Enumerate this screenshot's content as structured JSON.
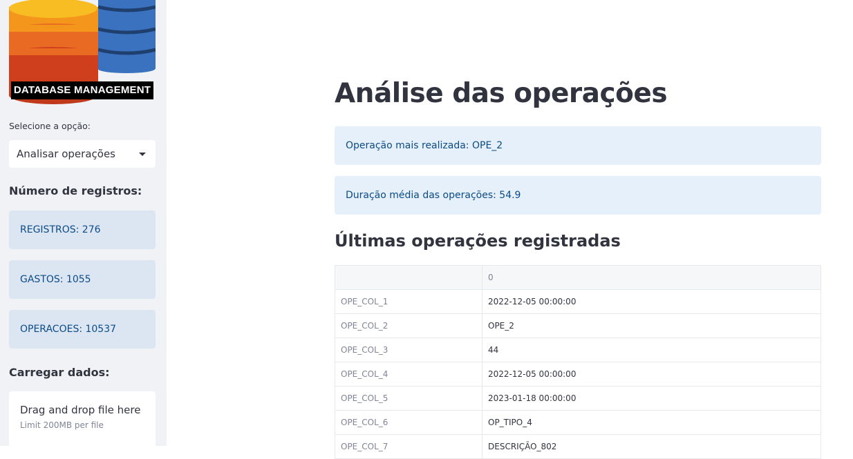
{
  "sidebar": {
    "logo_text": "DATABASE MANAGEMENT",
    "select_label": "Selecione a opção:",
    "select_value": "Analisar operações",
    "records_heading": "Número de registros:",
    "counts": [
      {
        "label": "REGISTROS: 276"
      },
      {
        "label": "GASTOS: 1055"
      },
      {
        "label": "OPERACOES: 10537"
      }
    ],
    "upload_heading": "Carregar dados:",
    "upload_title": "Drag and drop file here",
    "upload_limit": "Limit 200MB per file"
  },
  "main": {
    "title": "Análise das operações",
    "info_most": "Operação mais realizada: OPE_2",
    "info_duration": "Duração média das operações: 54.9",
    "subtitle": "Últimas operações registradas",
    "table": {
      "column_header": "0",
      "rows": [
        {
          "index": "OPE_COL_1",
          "value": "2022-12-05 00:00:00"
        },
        {
          "index": "OPE_COL_2",
          "value": "OPE_2"
        },
        {
          "index": "OPE_COL_3",
          "value": "44"
        },
        {
          "index": "OPE_COL_4",
          "value": "2022-12-05 00:00:00"
        },
        {
          "index": "OPE_COL_5",
          "value": "2023-01-18 00:00:00"
        },
        {
          "index": "OPE_COL_6",
          "value": "OP_TIPO_4"
        },
        {
          "index": "OPE_COL_7",
          "value": "DESCRIÇÃO_802"
        }
      ]
    }
  },
  "colors": {
    "sidebar_bg": "#f0f2f6",
    "info_bg": "#e5f0fa",
    "info_text": "#0b4a88",
    "logo_orange": "#f0921f",
    "logo_blue": "#2f6cb8"
  }
}
